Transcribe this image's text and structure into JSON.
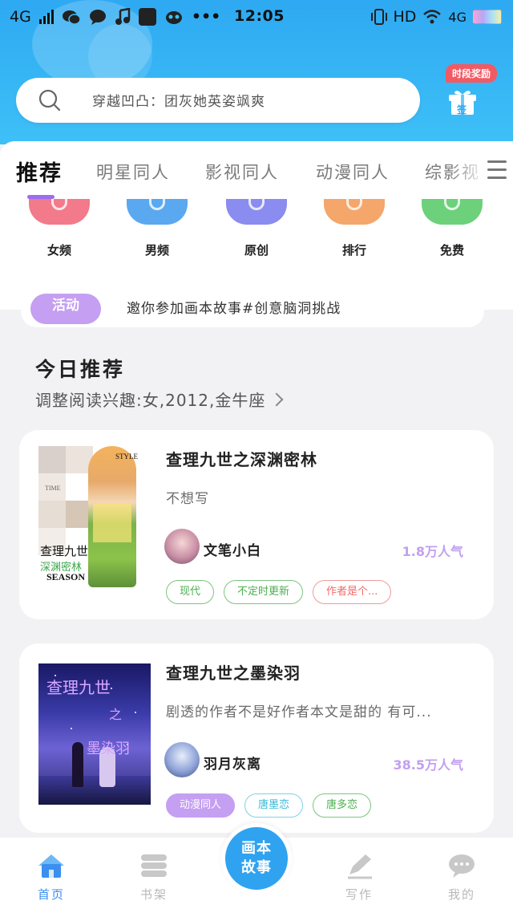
{
  "status_bar": {
    "carrier_left": "4G",
    "time": "12:05",
    "network_label": "HD",
    "network_right": "4G"
  },
  "search": {
    "placeholder": "穿越凹凸：团灰她英姿飒爽"
  },
  "reward": {
    "tag": "时段奖励",
    "icon_label": "签"
  },
  "tabs": [
    "推荐",
    "明星同人",
    "影视同人",
    "动漫同人",
    "综影视"
  ],
  "categories": [
    {
      "label": "女频",
      "color": "#f27a8a"
    },
    {
      "label": "男频",
      "color": "#5aa8f0"
    },
    {
      "label": "原创",
      "color": "#8a8cf0"
    },
    {
      "label": "排行",
      "color": "#f5a66a"
    },
    {
      "label": "免费",
      "color": "#6cd17a"
    }
  ],
  "activity": {
    "badge": "活动",
    "text": "邀你参加画本故事#创意脑洞挑战"
  },
  "section": {
    "title": "今日推荐",
    "subtitle": "调整阅读兴趣:女,2012,金牛座"
  },
  "books": [
    {
      "title": "查理九世之深渊密林",
      "desc": "不想写",
      "author": "文笔小白",
      "popularity": "1.8万人气",
      "cover_texts": [
        "STYLE",
        "TIME",
        "查理九世",
        "深渊密林",
        "SEASON"
      ],
      "tags": [
        {
          "label": "现代",
          "color": "#4caf50"
        },
        {
          "label": "不定时更新",
          "color": "#4caf50"
        },
        {
          "label": "作者是个...",
          "color": "#f06a6a"
        }
      ]
    },
    {
      "title": "查理九世之墨染羽",
      "desc": "剧透的作者不是好作者本文是甜的 有可...",
      "author": "羽月灰离",
      "popularity": "38.5万人气",
      "cover_texts": [
        "查理九世",
        "之",
        "墨染羽"
      ],
      "tags": [
        {
          "label": "动漫同人",
          "color": "#b388f0",
          "filled": true
        },
        {
          "label": "唐墨恋",
          "color": "#3ab8d8"
        },
        {
          "label": "唐多恋",
          "color": "#4caf50"
        }
      ]
    }
  ],
  "bottom_nav": {
    "home": "首页",
    "shelf": "书架",
    "center": [
      "画本",
      "故事"
    ],
    "write": "写作",
    "mine": "我的"
  },
  "colors": {
    "accent": "#2fa3f0",
    "purple": "#9b6df0"
  }
}
